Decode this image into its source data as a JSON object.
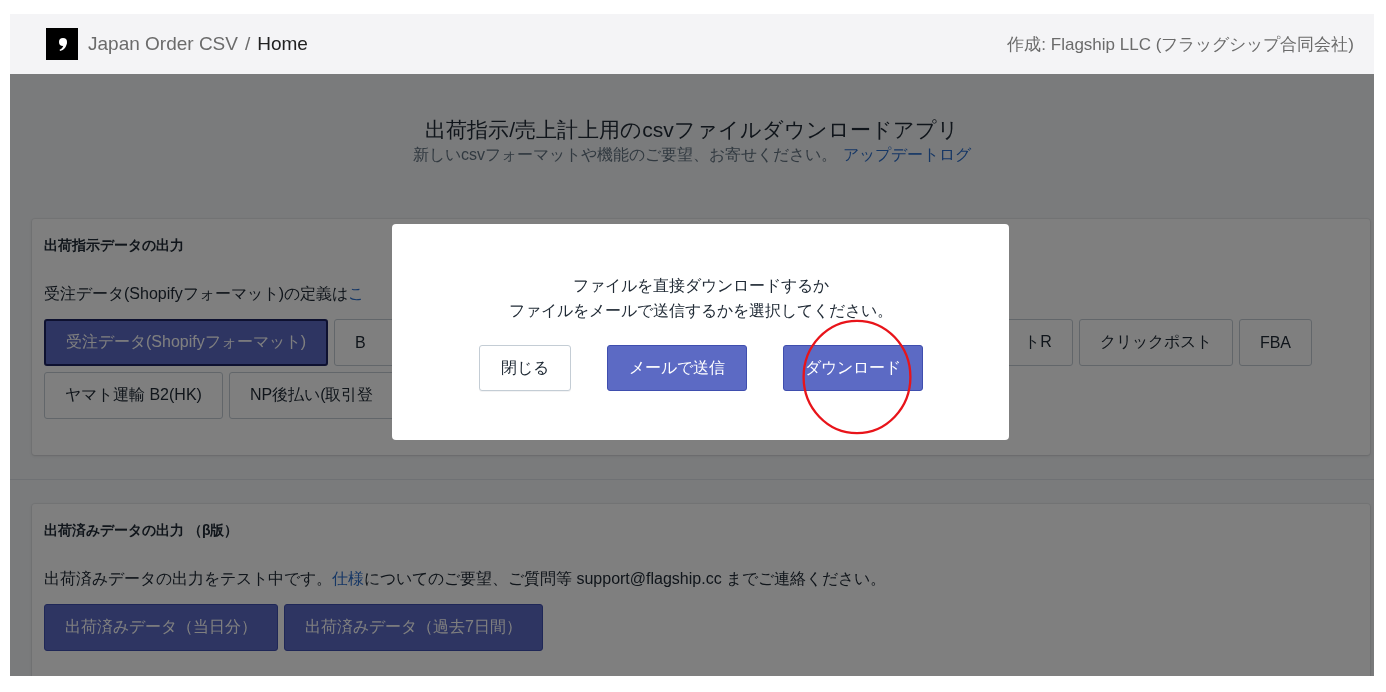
{
  "header": {
    "app_name": "Japan Order CSV",
    "separator": "/",
    "page": "Home",
    "credit": "作成: Flagship LLC (フラッグシップ合同会社)"
  },
  "intro": {
    "title": "出荷指示/売上計上用のcsvファイルダウンロードアプリ",
    "subtitle": "新しいcsvフォーマットや機能のご要望、お寄せください。",
    "link": "アップデートログ"
  },
  "sections": [
    {
      "heading": "出荷指示データの出力",
      "description": {
        "text_before": "受注データ(Shopifyフォーマット)の定義は",
        "link": "こ"
      },
      "button_rows": [
        [
          {
            "label": "受注データ(Shopifyフォーマット)",
            "kind": "primary"
          },
          {
            "label": "B",
            "kind": "hidden_end"
          },
          {
            "label": "トR",
            "kind": "hidden_start"
          },
          {
            "label": "クリックポスト",
            "kind": "default"
          },
          {
            "label": "FBA",
            "kind": "default"
          }
        ],
        [
          {
            "label": "ヤマト運輸 B2(HK)",
            "kind": "default"
          },
          {
            "label": "NP後払い(取引登",
            "kind": "hidden_end"
          }
        ]
      ]
    },
    {
      "heading": "出荷済みデータの出力 （β版）",
      "description": {
        "text_before": "出荷済みデータの出力をテスト中です。",
        "link": "仕様",
        "text_after": "についてのご要望、ご質問等 support@flagship.cc までご連絡ください。"
      },
      "button_rows": [
        [
          {
            "label": "出荷済みデータ（当日分）",
            "kind": "primary"
          },
          {
            "label": "出荷済みデータ（過去7日間）",
            "kind": "primary"
          }
        ]
      ]
    }
  ],
  "modal": {
    "message": [
      "ファイルを直接ダウンロードするか",
      "ファイルをメールで送信するかを選択してください。"
    ],
    "buttons": [
      {
        "label": "閉じる",
        "kind": "secondary"
      },
      {
        "label": "メールで送信",
        "kind": "primary"
      },
      {
        "label": "ダウンロード",
        "kind": "primary",
        "circled": true
      }
    ]
  }
}
